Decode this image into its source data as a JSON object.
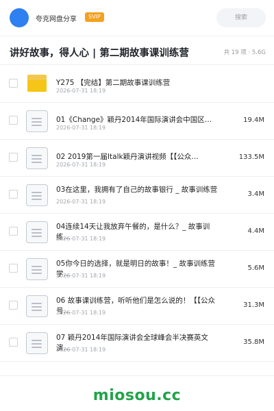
{
  "header": {
    "app_name": "夸克网盘分享",
    "badge": "SVIP",
    "search_label": "搜索"
  },
  "folder": {
    "title": "讲好故事，得人心 | 第二期故事课训练营",
    "summary": "共 19 项 · 5.6G"
  },
  "files": [
    {
      "type": "folder",
      "name": "Y275 【完结】第二期故事课训练营",
      "date": "2026-07-31 18:19",
      "size": ""
    },
    {
      "type": "file",
      "name": "01《Change》颖丹2014年国际演讲会中国区…",
      "date": "2026-07-31 18:19",
      "size": "19.4M"
    },
    {
      "type": "file",
      "name": "02 2019第一届Italk颖丹演讲视频【【公众…",
      "date": "2026-07-31 18:19",
      "size": "133.5M"
    },
    {
      "type": "file",
      "name": "03在这里，我拥有了自己的故事银行 _ 故事训练营",
      "date": "2026-07-31 18:19",
      "size": "3.4M"
    },
    {
      "type": "file",
      "name": "04连续14天让我放弃午餐的，是什么？_ 故事训练…",
      "date": "2026-07-31 18:19",
      "size": "4.4M"
    },
    {
      "type": "file",
      "name": "05你今日的选择，就是明日的故事！_ 故事训练营学…",
      "date": "2026-07-31 18:19",
      "size": "5.6M"
    },
    {
      "type": "file",
      "name": "06 故事课训练营，听听他们是怎么说的！【【公众号…",
      "date": "2026-07-31 18:19",
      "size": "31.3M"
    },
    {
      "type": "file",
      "name": "07 颖丹2014年国际演讲会全球峰会半决赛英文演…",
      "date": "2026-07-31 18:19",
      "size": "35.8M"
    }
  ],
  "watermark": "miosou.cc",
  "colors": {
    "accent": "#2f80f0",
    "svip": "#f5a01f",
    "folder": "#f5c518",
    "watermark": "#22a34a"
  }
}
